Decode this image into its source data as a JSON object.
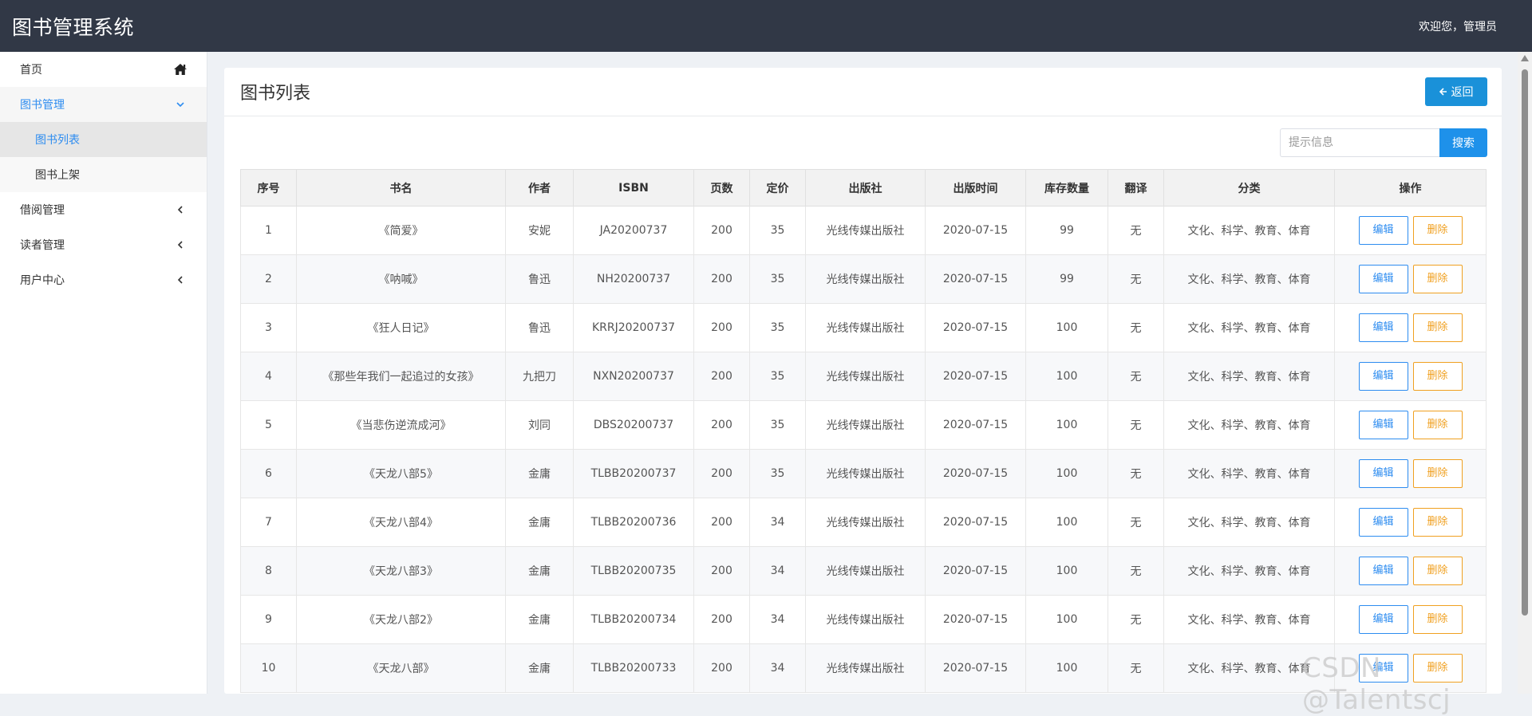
{
  "header": {
    "title": "图书管理系统",
    "welcome": "欢迎您，管理员"
  },
  "sidebar": {
    "items": [
      {
        "label": "首页"
      },
      {
        "label": "图书管理",
        "children": [
          {
            "label": "图书列表"
          },
          {
            "label": "图书上架"
          }
        ]
      },
      {
        "label": "借阅管理"
      },
      {
        "label": "读者管理"
      },
      {
        "label": "用户中心"
      }
    ]
  },
  "panel": {
    "title": "图书列表",
    "back_label": "返回"
  },
  "search": {
    "placeholder": "提示信息",
    "button_label": "搜索"
  },
  "table": {
    "headers": [
      "序号",
      "书名",
      "作者",
      "ISBN",
      "页数",
      "定价",
      "出版社",
      "出版时间",
      "库存数量",
      "翻译",
      "分类",
      "操作"
    ],
    "rows": [
      [
        "1",
        "《简爱》",
        "安妮",
        "JA20200737",
        "200",
        "35",
        "光线传媒出版社",
        "2020-07-15",
        "99",
        "无",
        "文化、科学、教育、体育"
      ],
      [
        "2",
        "《呐喊》",
        "鲁迅",
        "NH20200737",
        "200",
        "35",
        "光线传媒出版社",
        "2020-07-15",
        "99",
        "无",
        "文化、科学、教育、体育"
      ],
      [
        "3",
        "《狂人日记》",
        "鲁迅",
        "KRRJ20200737",
        "200",
        "35",
        "光线传媒出版社",
        "2020-07-15",
        "100",
        "无",
        "文化、科学、教育、体育"
      ],
      [
        "4",
        "《那些年我们一起追过的女孩》",
        "九把刀",
        "NXN20200737",
        "200",
        "35",
        "光线传媒出版社",
        "2020-07-15",
        "100",
        "无",
        "文化、科学、教育、体育"
      ],
      [
        "5",
        "《当悲伤逆流成河》",
        "刘同",
        "DBS20200737",
        "200",
        "35",
        "光线传媒出版社",
        "2020-07-15",
        "100",
        "无",
        "文化、科学、教育、体育"
      ],
      [
        "6",
        "《天龙八部5》",
        "金庸",
        "TLBB20200737",
        "200",
        "35",
        "光线传媒出版社",
        "2020-07-15",
        "100",
        "无",
        "文化、科学、教育、体育"
      ],
      [
        "7",
        "《天龙八部4》",
        "金庸",
        "TLBB20200736",
        "200",
        "34",
        "光线传媒出版社",
        "2020-07-15",
        "100",
        "无",
        "文化、科学、教育、体育"
      ],
      [
        "8",
        "《天龙八部3》",
        "金庸",
        "TLBB20200735",
        "200",
        "34",
        "光线传媒出版社",
        "2020-07-15",
        "100",
        "无",
        "文化、科学、教育、体育"
      ],
      [
        "9",
        "《天龙八部2》",
        "金庸",
        "TLBB20200734",
        "200",
        "34",
        "光线传媒出版社",
        "2020-07-15",
        "100",
        "无",
        "文化、科学、教育、体育"
      ],
      [
        "10",
        "《天龙八部》",
        "金庸",
        "TLBB20200733",
        "200",
        "34",
        "光线传媒出版社",
        "2020-07-15",
        "100",
        "无",
        "文化、科学、教育、体育"
      ]
    ],
    "edit_label": "编辑",
    "delete_label": "删除"
  },
  "watermark": "CSDN @Talentscj",
  "icons": {
    "home": "home-icon",
    "chevron_down": "chevron-down-icon",
    "chevron_left": "chevron-left-icon",
    "arrow_left": "arrow-left-icon"
  }
}
